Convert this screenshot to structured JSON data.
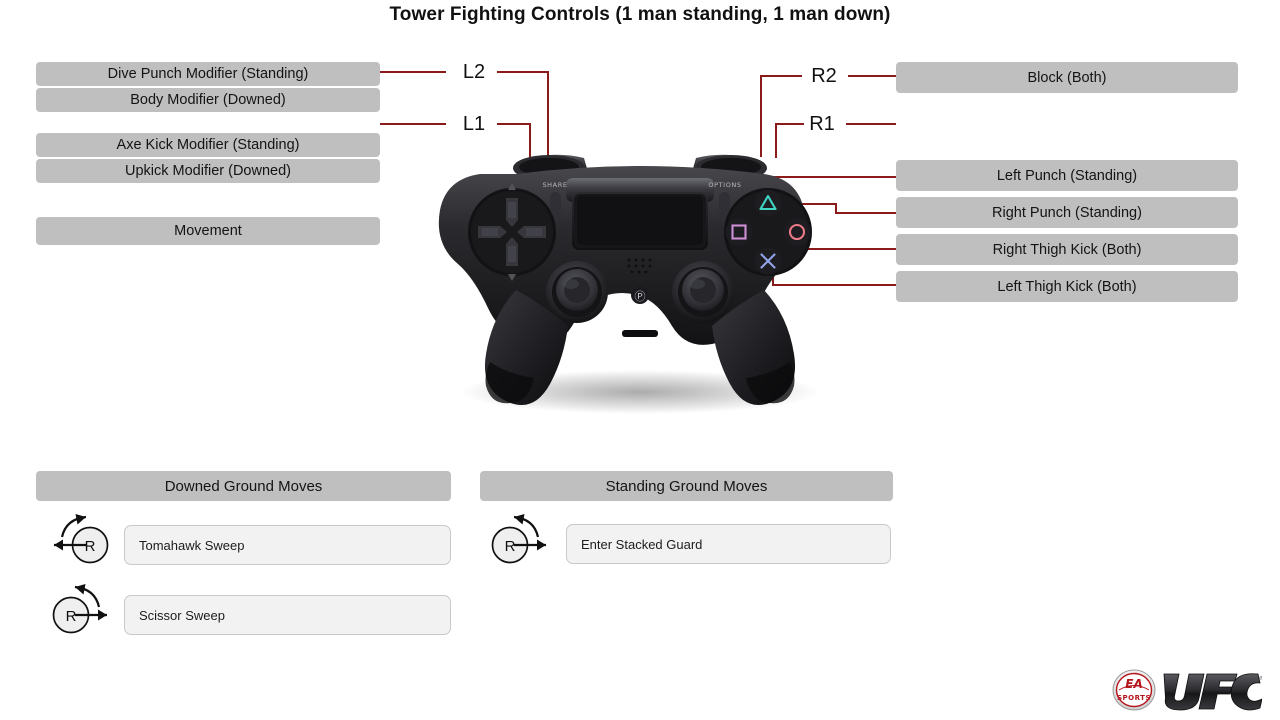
{
  "page": {
    "title": "Tower Fighting Controls (1 man standing, 1 man down)"
  },
  "theme": {
    "chip_gray": "#bfbfbf",
    "connector_red": "#8b1a1a",
    "move_box_fill": "#f2f2f2",
    "move_box_border": "#c9c9c9",
    "background": "#ffffff",
    "text": "#141414"
  },
  "left_labels": [
    {
      "id": "dive-punch-modifier",
      "text": "Dive Punch Modifier (Standing)"
    },
    {
      "id": "body-modifier",
      "text": "Body Modifier (Downed)"
    },
    {
      "id": "axe-kick-modifier",
      "text": "Axe Kick Modifier (Standing)"
    },
    {
      "id": "upkick-modifier",
      "text": "Upkick Modifier (Downed)"
    },
    {
      "id": "movement",
      "text": "Movement"
    }
  ],
  "right_labels": [
    {
      "id": "block",
      "text": "Block (Both)"
    },
    {
      "id": "left-punch",
      "text": "Left Punch (Standing)"
    },
    {
      "id": "right-punch",
      "text": "Right Punch (Standing)"
    },
    {
      "id": "right-thigh-kick",
      "text": "Right Thigh Kick (Both)"
    },
    {
      "id": "left-thigh-kick",
      "text": "Left Thigh Kick (Both)"
    }
  ],
  "shoulder_keys": {
    "l2": "L2",
    "l1": "L1",
    "r2": "R2",
    "r1": "R1"
  },
  "ground_sections": [
    {
      "id": "downed-ground-moves",
      "header": "Downed Ground Moves",
      "moves": [
        {
          "id": "tomahawk-sweep",
          "stick": "R",
          "gesture": "rotate-counterclockwise-left",
          "text": "Tomahawk Sweep"
        },
        {
          "id": "scissor-sweep",
          "stick": "R",
          "gesture": "rotate-clockwise-right",
          "text": "Scissor Sweep"
        }
      ]
    },
    {
      "id": "standing-ground-moves",
      "header": "Standing Ground Moves",
      "moves": [
        {
          "id": "enter-stacked-guard",
          "stick": "R",
          "gesture": "rotate-clockwise-right",
          "text": "Enter Stacked Guard"
        }
      ]
    }
  ],
  "controller": {
    "name": "DualShock 4 Controller",
    "face_buttons": [
      "square",
      "triangle",
      "circle",
      "cross"
    ],
    "labels": {
      "share": "SHARE",
      "options": "OPTIONS"
    }
  },
  "logo": {
    "brand": "EA",
    "sports": "SPORTS",
    "title": "UFC",
    "trademark": "®"
  }
}
